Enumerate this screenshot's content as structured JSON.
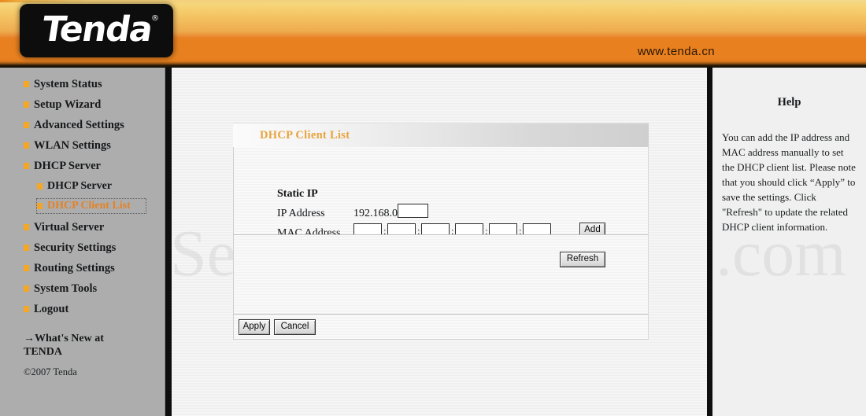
{
  "header": {
    "logo_text": "Tenda",
    "logo_registered_mark": "®",
    "url": "www.tenda.cn"
  },
  "sidebar": {
    "items": [
      {
        "label": "System Status",
        "level": "top",
        "active": false
      },
      {
        "label": "Setup Wizard",
        "level": "top",
        "active": false
      },
      {
        "label": "Advanced Settings",
        "level": "top",
        "active": false
      },
      {
        "label": "WLAN Settings",
        "level": "top",
        "active": false
      },
      {
        "label": "DHCP Server",
        "level": "top",
        "active": false
      },
      {
        "label": "DHCP Server",
        "level": "sub",
        "active": false
      },
      {
        "label": "DHCP Client List",
        "level": "sub",
        "active": true
      },
      {
        "label": "Virtual Server",
        "level": "top",
        "active": false
      },
      {
        "label": "Security Settings",
        "level": "top",
        "active": false
      },
      {
        "label": "Routing Settings",
        "level": "top",
        "active": false
      },
      {
        "label": "System Tools",
        "level": "top",
        "active": false
      },
      {
        "label": "Logout",
        "level": "top",
        "active": false
      }
    ],
    "whats_new": "→What's New at TENDA",
    "copyright": "©2007 Tenda"
  },
  "main": {
    "panel_title": "DHCP Client List",
    "watermark": "SetupRouter.com",
    "static_ip_heading": "Static IP",
    "ip_address_label": "IP Address",
    "ip_address_prefix": "192.168.0.",
    "ip_address_value": "",
    "ip_address_placeholder": "",
    "mac_address_label": "MAC Address",
    "mac_separator": ":",
    "mac_octets": [
      "",
      "",
      "",
      "",
      "",
      ""
    ],
    "add_label": "Add",
    "refresh_label": "Refresh",
    "apply_label": "Apply",
    "cancel_label": "Cancel"
  },
  "help": {
    "title": "Help",
    "body": "You can add the IP address and MAC address manually to set the DHCP client list. Please note that you should click “Apply” to save the settings. Click \"Refresh\" to update the related DHCP client information."
  },
  "colors": {
    "brand_orange": "#e8801f",
    "accent_amber": "#f5a623",
    "panel_title": "#e8a33c",
    "sidebar_bg": "#adadad",
    "help_bg": "#f0f0f0"
  }
}
